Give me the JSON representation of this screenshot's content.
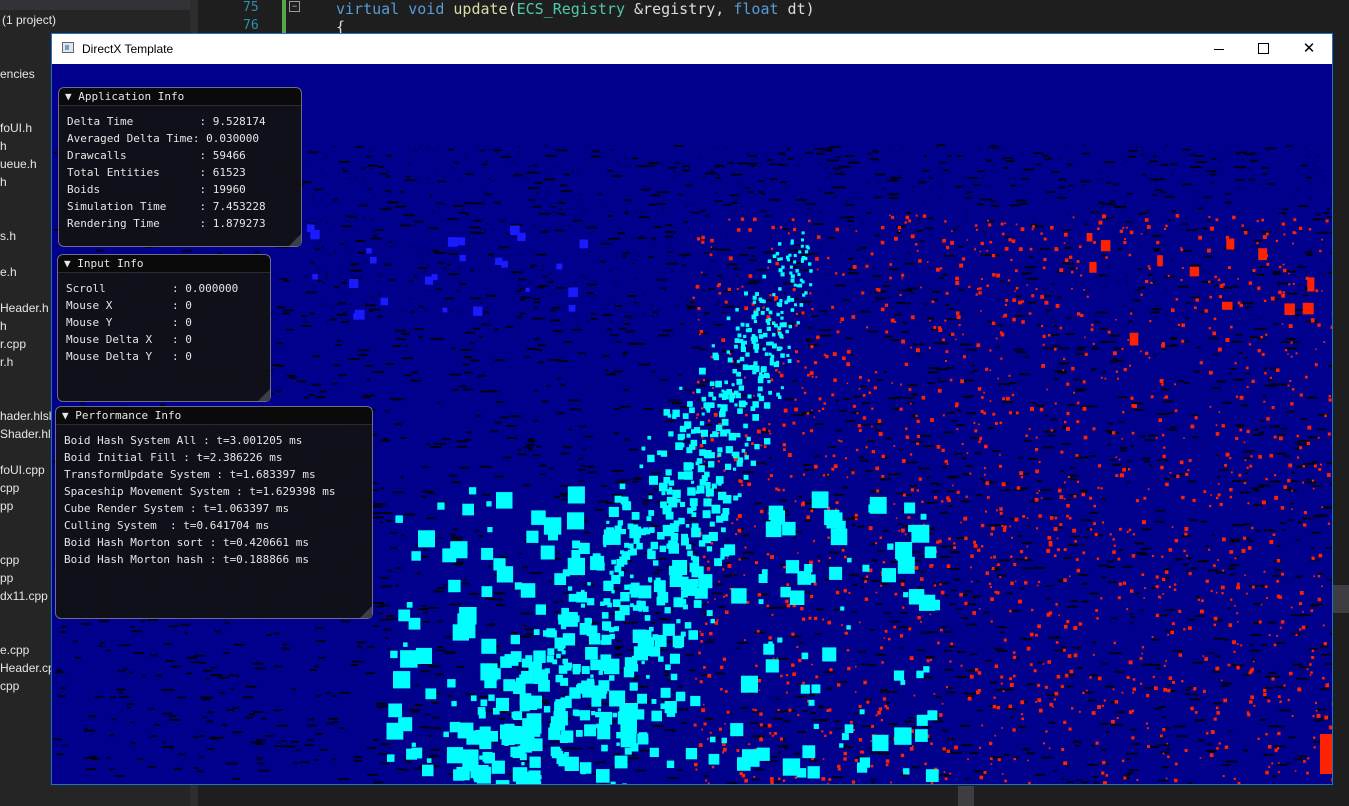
{
  "ide": {
    "solution_label": "(1 project)",
    "files": [
      {
        "label": "encies"
      },
      {
        "label": "foUI.h"
      },
      {
        "label": "h"
      },
      {
        "label": "ueue.h"
      },
      {
        "label": "h"
      },
      {
        "label": "s.h"
      },
      {
        "label": "e.h"
      },
      {
        "label": "Header.h"
      },
      {
        "label": "h"
      },
      {
        "label": "r.cpp"
      },
      {
        "label": "r.h"
      },
      {
        "label": "hader.hlsl"
      },
      {
        "label": "Shader.hlsl"
      },
      {
        "label": "foUI.cpp"
      },
      {
        "label": "cpp"
      },
      {
        "label": "pp"
      },
      {
        "label": "cpp"
      },
      {
        "label": "pp"
      },
      {
        "label": "dx11.cpp"
      },
      {
        "label": "e.cpp"
      },
      {
        "label": "Header.cpp"
      },
      {
        "label": "cpp"
      }
    ],
    "line_numbers": [
      "75",
      "76"
    ],
    "code": {
      "kw1": "virtual",
      "kw2": "void",
      "fn": "update",
      "type": "ECS_Registry",
      "p1": " &registry, ",
      "kw3": "float",
      "p2": " dt)",
      "brace": "{"
    }
  },
  "window": {
    "title": "DirectX Template",
    "min_symbol": "",
    "max_symbol": "",
    "close_symbol": "✕"
  },
  "colors": {
    "background": "#00008c",
    "cyan_boids": "#00ffff",
    "red_boids": "#ff2200",
    "blue_boids": "#1a1aff"
  },
  "panels": {
    "application": {
      "title": "▼ Application Info",
      "rows": [
        "Delta Time          : 9.528174",
        "Averaged Delta Time: 0.030000",
        "Drawcalls           : 59466",
        "Total Entities      : 61523",
        "Boids               : 19960",
        "Simulation Time     : 7.453228",
        "Rendering Time      : 1.879273"
      ]
    },
    "input": {
      "title": "▼ Input Info",
      "rows": [
        "Scroll          : 0.000000",
        "Mouse X         : 0",
        "Mouse Y         : 0",
        "Mouse Delta X   : 0",
        "Mouse Delta Y   : 0"
      ]
    },
    "performance": {
      "title": "▼ Performance Info",
      "rows": [
        "Boid Hash System All : t=3.001205 ms",
        "Boid Initial Fill : t=2.386226 ms",
        "TransformUpdate System : t=1.683397 ms",
        "Spaceship Movement System : t=1.629398 ms",
        "Cube Render System : t=1.063397 ms",
        "Culling System  : t=0.641704 ms",
        "Boid Hash Morton sort : t=0.420661 ms",
        "Boid Hash Morton hash : t=0.188866 ms"
      ]
    }
  }
}
